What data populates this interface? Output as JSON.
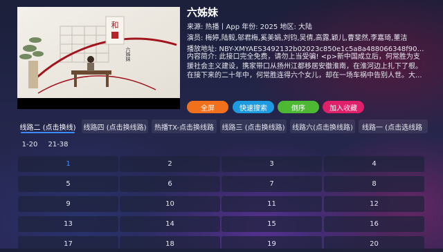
{
  "detail": {
    "title": "六姊妹",
    "source_line": "来源:  热播丨App  年份:  2025  地区:  大陆",
    "actors_line": "演员:  梅婷,陆毅,邬君梅,奚美娟,刘钧,吴倩,高露,颖儿,曹斐然,李嘉琦,董洁",
    "play_url_line": "播放地址:  NBY-XMYAES3492132b02023c850e1c5a8a488066348f90af8f...",
    "description": "内容简介:  此接口完全免费，请勿上当受骗! <p>新中国成立后，何常胜为支援社会主义建设，携家带口从扬州江都移居安徽淮南，在淮河边上扎下了根。在接下来的二十年中，何常胜连得六个女儿，却在一场车祸中告别人世。大..."
  },
  "poster": {
    "stamp_char": "和",
    "caption_text": "六姊妹"
  },
  "actions": {
    "fullscreen": "全屏",
    "quick_search": "快速搜索",
    "reverse": "倒序",
    "favorite": "加入收藏",
    "colors": {
      "fullscreen": "#f0701c",
      "quick_search": "#1e9be0",
      "reverse": "#4cb833",
      "favorite": "#e0206a"
    }
  },
  "lines": [
    "线路二 (点击换线)",
    "线路四 (点击换线路)",
    "热播TX-点击换线路",
    "线路三 (点击换线路)",
    "线路六(点击换线路)",
    "线路一 (点击选线路"
  ],
  "ranges": [
    "1-20",
    "21-38"
  ],
  "episodes": [
    "1",
    "2",
    "3",
    "4",
    "5",
    "6",
    "7",
    "8",
    "9",
    "10",
    "11",
    "12",
    "13",
    "14",
    "15",
    "16",
    "17",
    "18",
    "19",
    "20"
  ],
  "current_episode": "1"
}
